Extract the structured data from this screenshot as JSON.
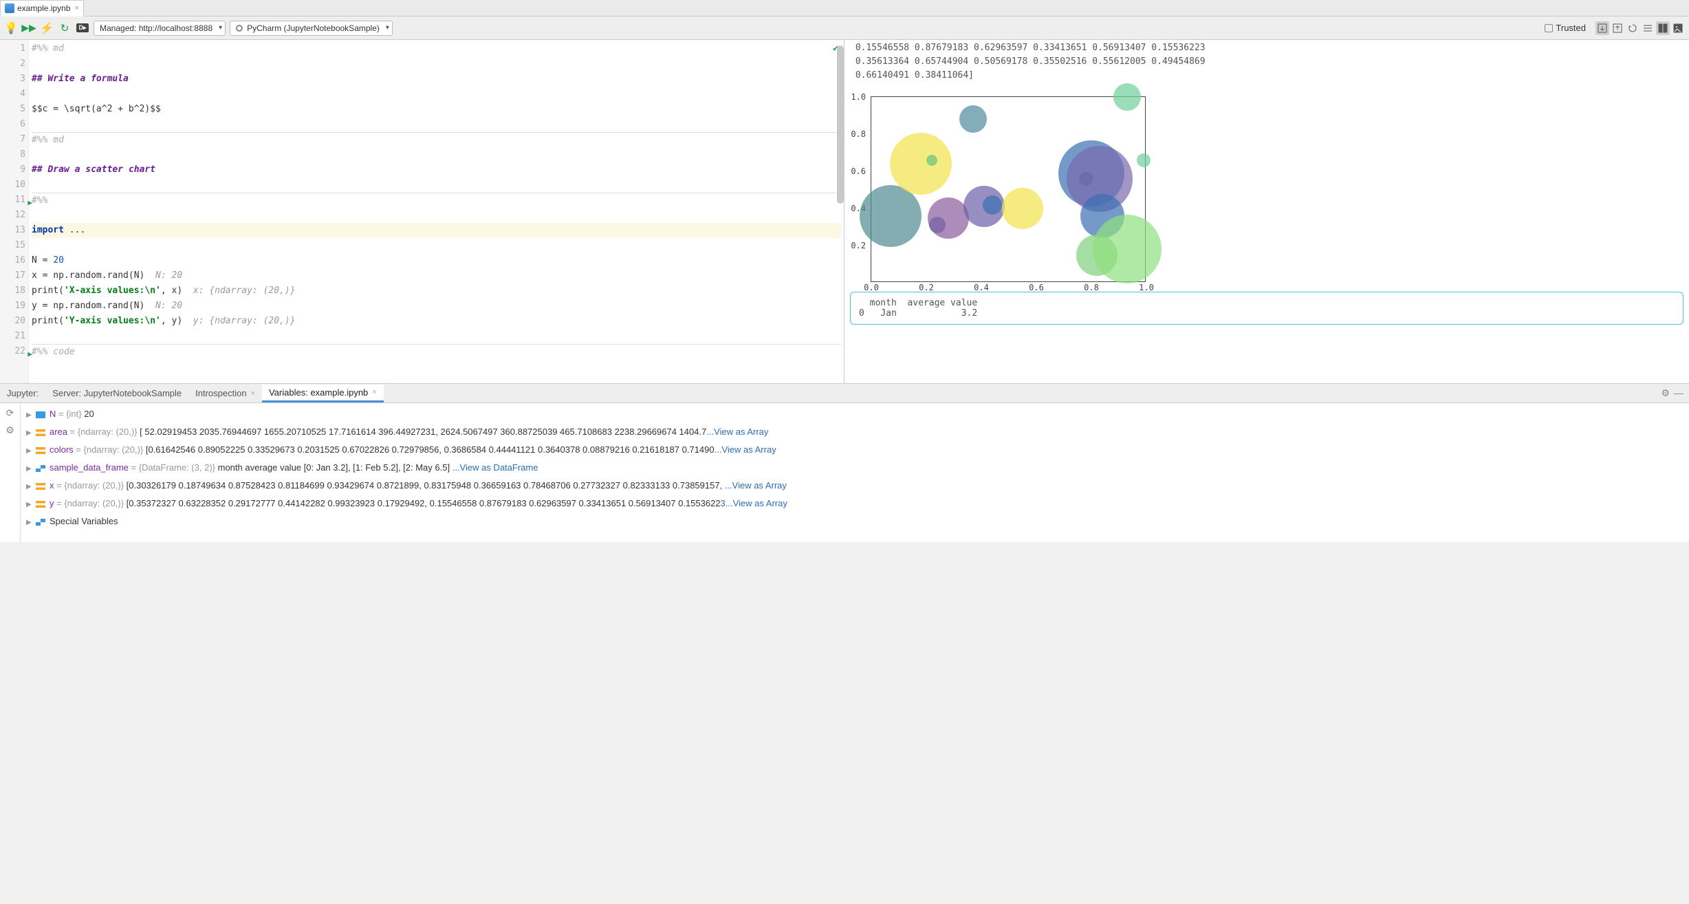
{
  "tab": {
    "filename": "example.ipynb"
  },
  "toolbar": {
    "server_combo": "Managed: http://localhost:8888",
    "env_combo": "PyCharm (JupyterNotebookSample)",
    "trusted": "Trusted"
  },
  "editor_lines": [
    {
      "n": "1",
      "c": "#%% md",
      "cls": "cm-comment"
    },
    {
      "n": "2",
      "c": "",
      "cls": ""
    },
    {
      "n": "3",
      "c": "## Write a formula",
      "cls": "cm-head"
    },
    {
      "n": "4",
      "c": "",
      "cls": ""
    },
    {
      "n": "5",
      "c": "$$c = \\sqrt(a^2 + b^2)$$",
      "cls": ""
    },
    {
      "n": "6",
      "c": "",
      "cls": ""
    },
    {
      "n": "7",
      "c": "#%% md",
      "cls": "cm-comment",
      "sep": true
    },
    {
      "n": "8",
      "c": "",
      "cls": ""
    },
    {
      "n": "9",
      "c": "## Draw a scatter chart",
      "cls": "cm-head"
    },
    {
      "n": "10",
      "c": "",
      "cls": ""
    },
    {
      "n": "11",
      "c": "#%%",
      "cls": "cm-comment",
      "sep": true,
      "run": true
    },
    {
      "n": "12",
      "c": "",
      "cls": ""
    },
    {
      "n": "13",
      "html": "<span class=\"cm-kw\">import</span> ...",
      "hl": true
    },
    {
      "n": "15",
      "c": "",
      "cls": ""
    },
    {
      "n": "16",
      "html": "N = <span class=\"cm-num\">20</span>"
    },
    {
      "n": "17",
      "html": "x = np.random.rand(N)&nbsp;&nbsp;<span class=\"cm-hint\">N: 20</span>"
    },
    {
      "n": "18",
      "html": "print(<span class=\"cm-str\">'X-axis values:\\n'</span>, x)&nbsp;&nbsp;<span class=\"cm-hint\">x: {ndarray: (20,)}</span>"
    },
    {
      "n": "19",
      "html": "y = np.random.rand(N)&nbsp;&nbsp;<span class=\"cm-hint\">N: 20</span>"
    },
    {
      "n": "20",
      "html": "print(<span class=\"cm-str\">'Y-axis values:\\n'</span>, y)&nbsp;&nbsp;<span class=\"cm-hint\">y: {ndarray: (20,)}</span>"
    },
    {
      "n": "21",
      "c": "",
      "cls": ""
    },
    {
      "n": "22",
      "c": "#%% code",
      "cls": "cm-comment",
      "sep": true,
      "run": true
    }
  ],
  "output_tail": " 0.15546558 0.87679183 0.62963597 0.33413651 0.56913407 0.15536223\n 0.35613364 0.65744904 0.50569178 0.35502516 0.55612005 0.49454869\n 0.66140491 0.38411064]",
  "df_output": "  month  average value\n0   Jan            3.2",
  "chart_data": {
    "type": "scatter",
    "xlabel": "",
    "ylabel": "",
    "xlim": [
      0,
      1.0
    ],
    "ylim": [
      0,
      1.0
    ],
    "xticks": [
      0.0,
      0.2,
      0.4,
      0.6,
      0.8,
      1.0
    ],
    "yticks": [
      0.2,
      0.4,
      0.6,
      0.8,
      1.0
    ],
    "points": [
      {
        "x": 0.07,
        "y": 0.36,
        "r": 45,
        "c": "#4e8a8f"
      },
      {
        "x": 0.18,
        "y": 0.64,
        "r": 45,
        "c": "#f2e24c"
      },
      {
        "x": 0.22,
        "y": 0.66,
        "r": 8,
        "c": "#63c47b"
      },
      {
        "x": 0.24,
        "y": 0.31,
        "r": 12,
        "c": "#3d769e"
      },
      {
        "x": 0.28,
        "y": 0.35,
        "r": 30,
        "c": "#8a5a9e"
      },
      {
        "x": 0.37,
        "y": 0.88,
        "r": 20,
        "c": "#4e8a9d"
      },
      {
        "x": 0.41,
        "y": 0.41,
        "r": 30,
        "c": "#6b5fa6"
      },
      {
        "x": 0.44,
        "y": 0.42,
        "r": 14,
        "c": "#3a6db0"
      },
      {
        "x": 0.55,
        "y": 0.4,
        "r": 30,
        "c": "#f2e24c"
      },
      {
        "x": 0.78,
        "y": 0.56,
        "r": 10,
        "c": "#305488"
      },
      {
        "x": 0.8,
        "y": 0.59,
        "r": 48,
        "c": "#3a6db0"
      },
      {
        "x": 0.83,
        "y": 0.56,
        "r": 48,
        "c": "#7b6aae"
      },
      {
        "x": 0.84,
        "y": 0.36,
        "r": 32,
        "c": "#3a6db0"
      },
      {
        "x": 0.82,
        "y": 0.15,
        "r": 30,
        "c": "#7fd07b"
      },
      {
        "x": 0.93,
        "y": 0.18,
        "r": 50,
        "c": "#8fe07f"
      },
      {
        "x": 0.93,
        "y": 1.0,
        "r": 20,
        "c": "#6ed09a"
      },
      {
        "x": 0.99,
        "y": 0.66,
        "r": 10,
        "c": "#6ed09a"
      }
    ]
  },
  "panel": {
    "label": "Jupyter:",
    "server_tab": "Server: JupyterNotebookSample",
    "intro_tab": "Introspection",
    "vars_tab": "Variables: example.ipynb"
  },
  "vars": [
    {
      "icon": "int",
      "name": "N",
      "rest": " = {int} 20"
    },
    {
      "icon": "arr",
      "name": "area",
      "rest": " = {ndarray: (20,)} [  52.02919453 2035.76944697 1655.20710525  17.7161614  396.44927231, 2624.5067497  360.88725039 465.7108683 2238.29669674 1404.7",
      "link": "...View as Array"
    },
    {
      "icon": "arr",
      "name": "colors",
      "rest": " = {ndarray: (20,)} [0.61642546 0.89052225 0.33529673 0.2031525  0.67022826 0.72979856, 0.3686584  0.44441121 0.3640378  0.08879216 0.21618187 0.71490",
      "link": "...View as Array"
    },
    {
      "icon": "df",
      "name": "sample_data_frame",
      "rest": " = {DataFrame: (3, 2)} month average value [0: Jan 3.2], [1: Feb 5.2], [2: May 6.5] ",
      "link": "...View as DataFrame"
    },
    {
      "icon": "arr",
      "name": "x",
      "rest": " = {ndarray: (20,)} [0.30326179 0.18749634 0.87528423 0.81184699 0.93429674 0.8721899, 0.83175948 0.36659163 0.78468706 0.27732327 0.82333133 0.73859157, ",
      "link": "...View as Array"
    },
    {
      "icon": "arr",
      "name": "y",
      "rest": " = {ndarray: (20,)} [0.35372327 0.63228352 0.29172777 0.44142282 0.99323923 0.17929492, 0.15546558 0.87679183 0.62963597 0.33413651 0.56913407 0.1553622",
      "link": "3...View as Array"
    },
    {
      "icon": "df",
      "name": "Special Variables",
      "rest": "",
      "plain": true
    }
  ]
}
